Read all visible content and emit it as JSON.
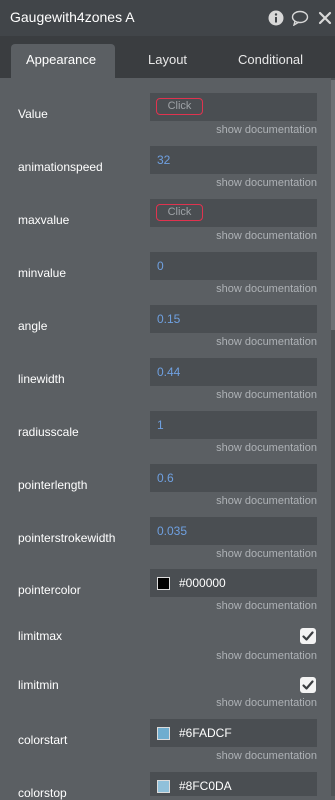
{
  "panel": {
    "title": "Gaugewith4zones A",
    "icons": [
      "info-icon",
      "comment-icon",
      "close-icon"
    ]
  },
  "tabs": [
    {
      "label": "Appearance",
      "active": true
    },
    {
      "label": "Layout",
      "active": false
    },
    {
      "label": "Conditional",
      "active": false
    }
  ],
  "doc_link": "show documentation",
  "properties": {
    "value": {
      "label": "Value",
      "placeholder": "Click"
    },
    "animationspeed": {
      "label": "animationspeed",
      "value": "32"
    },
    "maxvalue": {
      "label": "maxvalue",
      "placeholder": "Click"
    },
    "minvalue": {
      "label": "minvalue",
      "value": "0"
    },
    "angle": {
      "label": "angle",
      "value": "0.15"
    },
    "linewidth": {
      "label": "linewidth",
      "value": "0.44"
    },
    "radiusscale": {
      "label": "radiusscale",
      "value": "1"
    },
    "pointerlength": {
      "label": "pointerlength",
      "value": "0.6"
    },
    "pointerstrokewidth": {
      "label": "pointerstrokewidth",
      "value": "0.035"
    },
    "pointercolor": {
      "label": "pointercolor",
      "value": "#000000",
      "swatch": "#000000"
    },
    "limitmax": {
      "label": "limitmax",
      "checked": true
    },
    "limitmin": {
      "label": "limitmin",
      "checked": true
    },
    "colorstart": {
      "label": "colorstart",
      "value": "#6FADCF",
      "swatch": "#6FADCF"
    },
    "colorstop": {
      "label": "colorstop",
      "value": "#8FC0DA",
      "swatch": "#8FC0DA"
    }
  },
  "colors": {
    "background": "#5b5f63",
    "titlebar": "#414549",
    "tabbar": "#3a3d40",
    "field": "#4a4e52",
    "value_text": "#6fa0e0",
    "click_border": "#e0334f"
  }
}
